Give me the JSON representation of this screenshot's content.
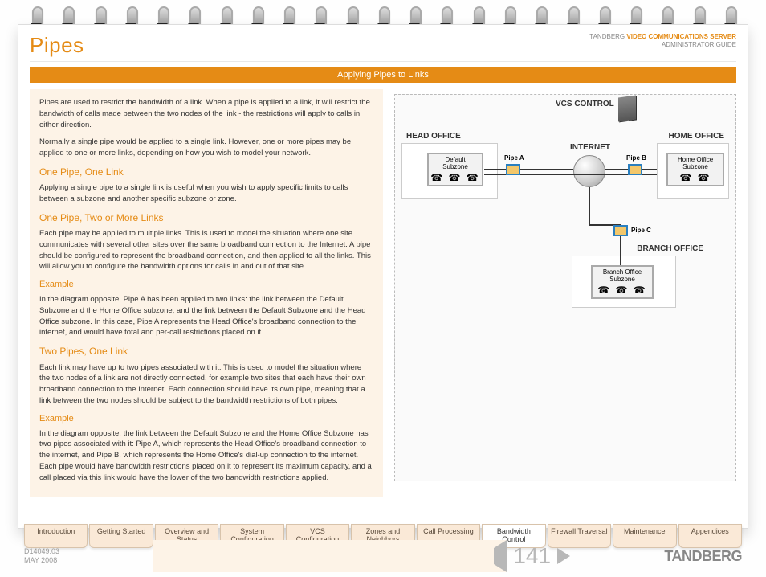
{
  "header": {
    "title": "Pipes",
    "brand": "TANDBERG",
    "product": "VIDEO COMMUNICATIONS SERVER",
    "guide": "ADMINISTRATOR GUIDE"
  },
  "banner": "Applying Pipes to Links",
  "content": {
    "intro1": "Pipes are used to restrict the bandwidth of a link.  When a pipe is applied to a link, it will restrict the bandwidth of calls made between the two nodes of the link - the restrictions will apply to calls in either direction.",
    "intro2": "Normally a single pipe would be applied to a single link.  However, one or more pipes may be applied to one or more links, depending on how you wish to model your network.",
    "s1_title": "One Pipe, One Link",
    "s1_body": "Applying a single pipe to a single link is useful when you wish to apply specific limits to calls between a subzone and another specific subzone or zone.",
    "s2_title": "One Pipe, Two or More Links",
    "s2_body": "Each pipe may be applied to multiple links.  This is used to model the situation where one site communicates with several other sites over the same broadband connection to the Internet. A pipe should be configured to represent the broadband connection, and then applied to all the links.  This will allow you to configure the bandwidth options for calls in and out of that site.",
    "s2_ex_title": "Example",
    "s2_ex_body": "In the diagram opposite, Pipe A has been applied to two links: the link between the Default Subzone and the Home Office subzone, and the link between the Default Subzone and the Head Office subzone.  In this case, Pipe A represents the Head Office's broadband connection to the internet, and would have total and per-call restrictions placed on it.",
    "s3_title": "Two Pipes, One Link",
    "s3_body": "Each link may have up to two pipes associated with it.  This is used to model the situation where the two nodes of a link are not directly connected, for example two sites that each have their own broadband connection to the Internet. Each connection should have its own pipe, meaning that a link between the two nodes should be subject to the bandwidth restrictions of both pipes.",
    "s3_ex_title": "Example",
    "s3_ex_body": "In the diagram opposite, the link between the Default Subzone and the Home Office Subzone has two pipes associated with it: Pipe A, which represents the Head Office's broadband connection to the internet, and Pipe B, which represents the Home Office's dial-up connection to the internet.  Each pipe would have bandwidth restrictions placed on it to represent its maximum capacity, and a call placed via this link would have the lower of the two bandwidth restrictions applied."
  },
  "diagram": {
    "vcs": "VCS CONTROL",
    "internet": "INTERNET",
    "head": "HEAD OFFICE",
    "home": "HOME OFFICE",
    "branch": "BRANCH OFFICE",
    "default_sz": "Default\nSubzone",
    "home_sz": "Home Office\nSubzone",
    "branch_sz": "Branch Office\nSubzone",
    "pipe_a": "Pipe A",
    "pipe_b": "Pipe B",
    "pipe_c": "Pipe C"
  },
  "tabs": [
    "Introduction",
    "Getting Started",
    "Overview and Status",
    "System Configuration",
    "VCS Configuration",
    "Zones and Neighbors",
    "Call Processing",
    "Bandwidth Control",
    "Firewall Traversal",
    "Maintenance",
    "Appendices"
  ],
  "active_tab": 7,
  "footer": {
    "docid": "D14049.03",
    "date": "MAY 2008",
    "page": "141",
    "brand": "TANDBERG"
  }
}
